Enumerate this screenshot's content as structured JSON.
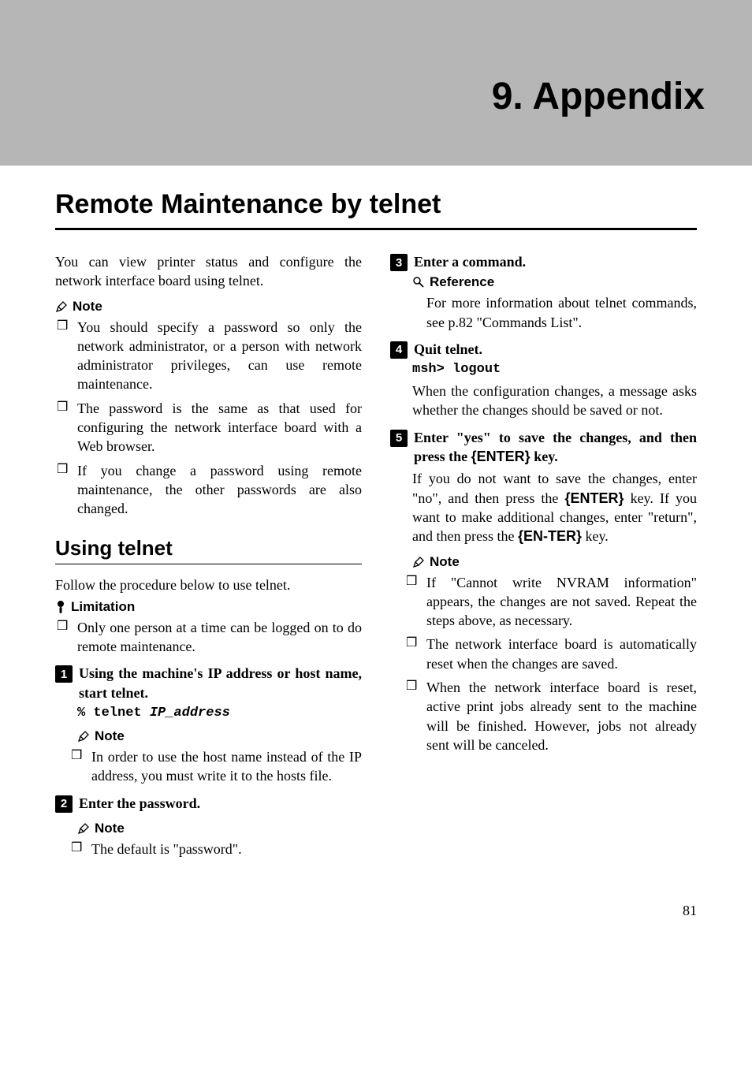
{
  "chapter_title": "9. Appendix",
  "section_title": "Remote Maintenance by telnet",
  "intro": "You can view printer status and configure the network interface board using telnet.",
  "note_label": "Note",
  "limitation_label": "Limitation",
  "reference_label": "Reference",
  "top_notes": [
    "You should specify a password so only the network administrator, or a person with network administrator privileges, can use remote maintenance.",
    "The password is the same as that used for configuring the network interface board with a Web browser.",
    "If you change a password using remote maintenance, the other passwords are also changed."
  ],
  "subsection_title": "Using telnet",
  "subsection_intro": "Follow the procedure below to use telnet.",
  "limitation_items": [
    "Only one person at a time can be logged on to do remote maintenance."
  ],
  "step1": {
    "text": "Using the machine's IP address or host name, start telnet.",
    "code_prefix": "% telnet ",
    "code_ital": "IP_address",
    "note_items": [
      "In order to use the host name instead of the IP address, you must write it to the hosts file."
    ]
  },
  "step2": {
    "text": "Enter the password.",
    "note_items": [
      "The default is \"password\"."
    ]
  },
  "step3": {
    "text": "Enter a command.",
    "reference_body": "For more information about telnet commands, see p.82 \"Commands List\"."
  },
  "step4": {
    "text": "Quit telnet.",
    "code": "msh> logout",
    "follow": "When the configuration changes, a message asks whether the changes should be saved or not."
  },
  "step5": {
    "text_pre": "Enter \"yes\" to save the changes, and then press the ",
    "key1": "{ENTER}",
    "text_post": " key.",
    "follow_pre": "If you do not want to save the changes, enter \"no\", and then press the ",
    "follow_key1": "{ENTER}",
    "follow_mid": " key. If you want to make additional changes, enter \"return\", and then press the ",
    "follow_key2": "{EN-TER}",
    "follow_end": " key.",
    "note_items": [
      "If \"Cannot write NVRAM information\" appears, the changes are not saved. Repeat the steps above, as necessary.",
      "The network interface board is automatically reset when the changes are saved.",
      "When the network interface board is reset, active print jobs already sent to the machine will be finished. However, jobs not already sent will be canceled."
    ]
  },
  "page_number": "81"
}
